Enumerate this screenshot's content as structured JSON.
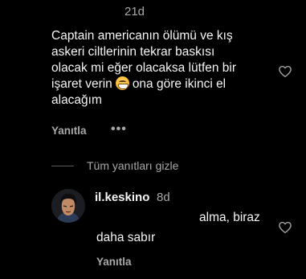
{
  "comment": {
    "time": "21d",
    "lines": [
      "Captain americanın ölümü ve kış",
      "askeri ciltlerinin tekrar baskısı",
      "olacak mi eğer olacaksa lütfen bir",
      "işaret verin",
      "ona göre ikinci el",
      "alacağım"
    ],
    "emoji": "grimacing-face",
    "reply_label": "Yanıtla",
    "more_label": "•••"
  },
  "hide_replies": {
    "label": "Tüm yanıtları gizle"
  },
  "reply": {
    "username": "il.keskino",
    "time": "8d",
    "text_line1": "alma, biraz",
    "text_line2": "daha sabır",
    "reply_label": "Yanıtla"
  },
  "colors": {
    "background": "#000000",
    "text": "#f5f5f5",
    "muted": "#a8a8a8"
  },
  "icons": {
    "like": "heart-outline-icon"
  }
}
